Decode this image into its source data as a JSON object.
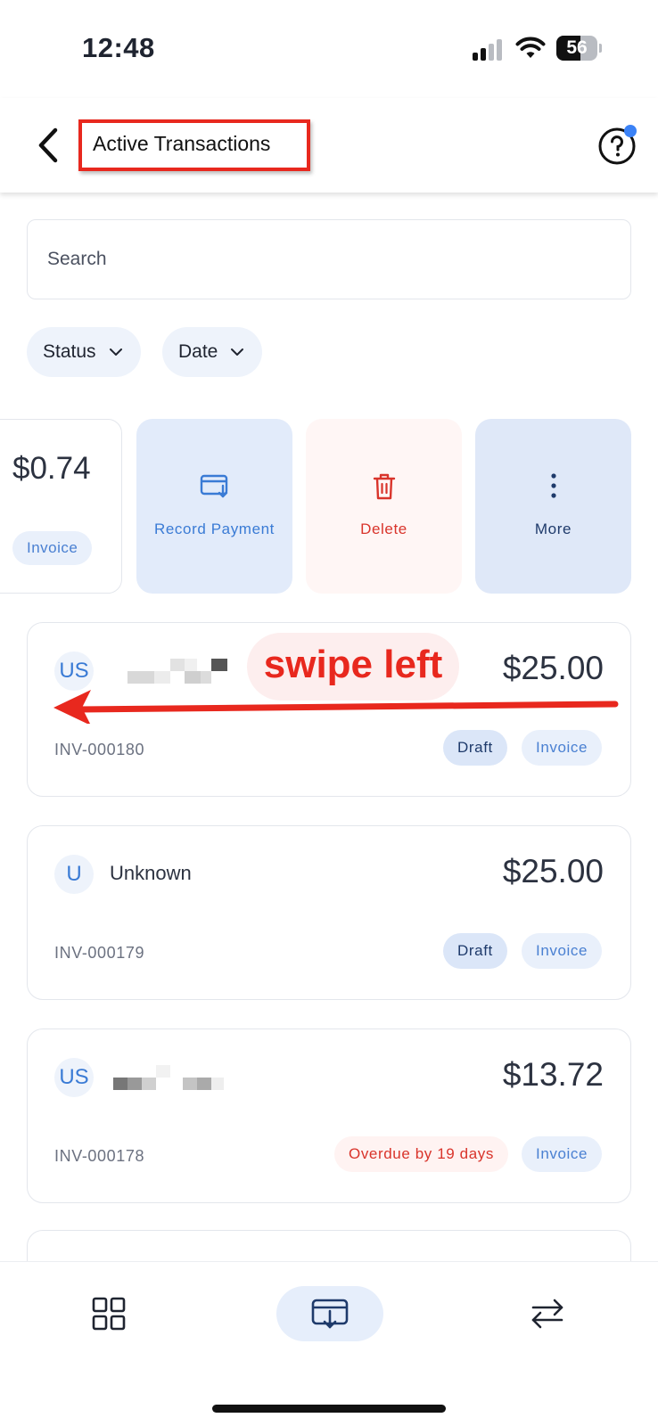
{
  "status_bar": {
    "time": "12:48",
    "battery": "56"
  },
  "header": {
    "title": "Active Transactions"
  },
  "search": {
    "placeholder": "Search"
  },
  "filters": [
    {
      "label": "Status"
    },
    {
      "label": "Date"
    }
  ],
  "swiped_card": {
    "amount": "$0.74",
    "type_badge": "Invoice"
  },
  "swipe_actions": [
    {
      "label": "Record Payment"
    },
    {
      "label": "Delete"
    },
    {
      "label": "More"
    }
  ],
  "annotation": {
    "text": "swipe left"
  },
  "transactions": [
    {
      "avatar": "US",
      "name": "",
      "amount": "$25.00",
      "number": "INV-000180",
      "status": "Draft",
      "type": "Invoice"
    },
    {
      "avatar": "U",
      "name": "Unknown",
      "amount": "$25.00",
      "number": "INV-000179",
      "status": "Draft",
      "type": "Invoice"
    },
    {
      "avatar": "US",
      "name": "",
      "amount": "$13.72",
      "number": "INV-000178",
      "status": "Overdue by 19 days",
      "type": "Invoice"
    }
  ],
  "colors": {
    "accent": "#3a7bd5",
    "danger": "#d9342b",
    "annotation_red": "#e8281e"
  },
  "icons": {
    "back": "chevron-left-icon",
    "help": "question-circle-icon",
    "record": "card-download-icon",
    "delete": "trash-icon",
    "more": "vertical-dots-icon",
    "nav_left": "grid-icon",
    "nav_center": "inbox-download-icon",
    "nav_right": "swap-arrows-icon"
  }
}
